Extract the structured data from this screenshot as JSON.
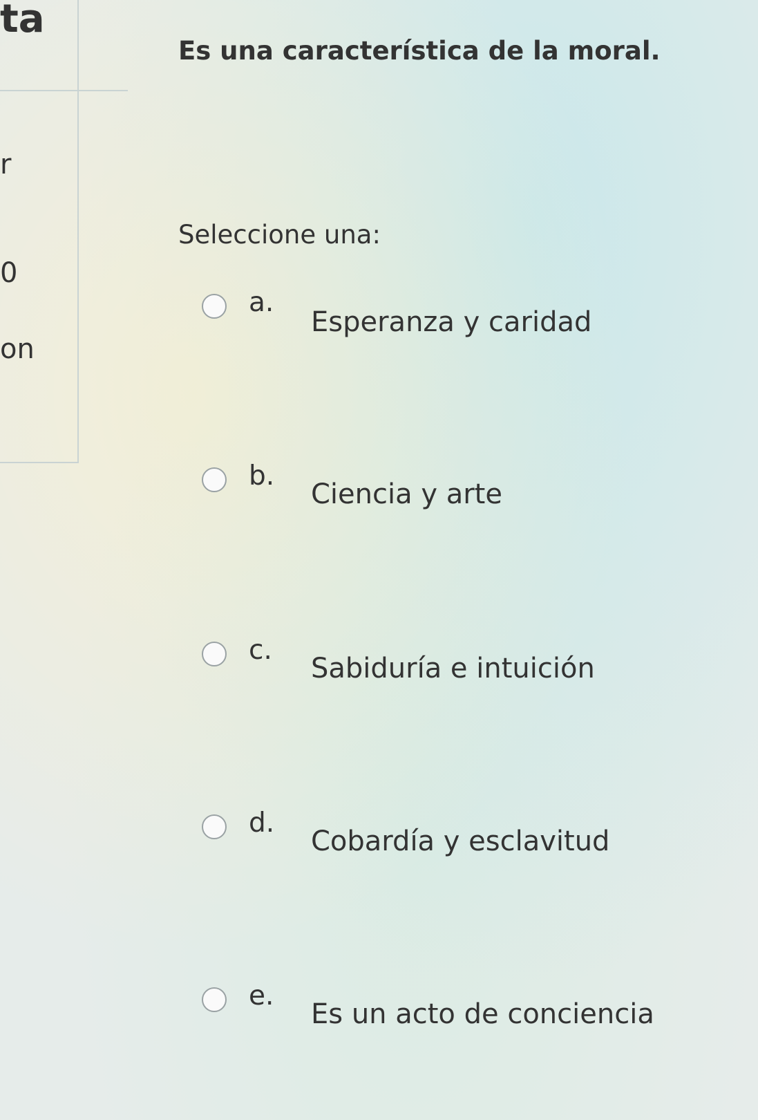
{
  "sidebar": {
    "heading": "ta",
    "line1": "r",
    "line2": "0",
    "line3": "on"
  },
  "question": {
    "text": "Es una característica de la moral.",
    "prompt": "Seleccione una:"
  },
  "options": [
    {
      "letter": "a.",
      "label": "Esperanza y caridad",
      "selected": false
    },
    {
      "letter": "b.",
      "label": "Ciencia y arte",
      "selected": false
    },
    {
      "letter": "c.",
      "label": "Sabiduría e intuición",
      "selected": false
    },
    {
      "letter": "d.",
      "label": "Cobardía y esclavitud",
      "selected": false
    },
    {
      "letter": "e.",
      "label": "Es un acto de conciencia",
      "selected": false
    }
  ]
}
